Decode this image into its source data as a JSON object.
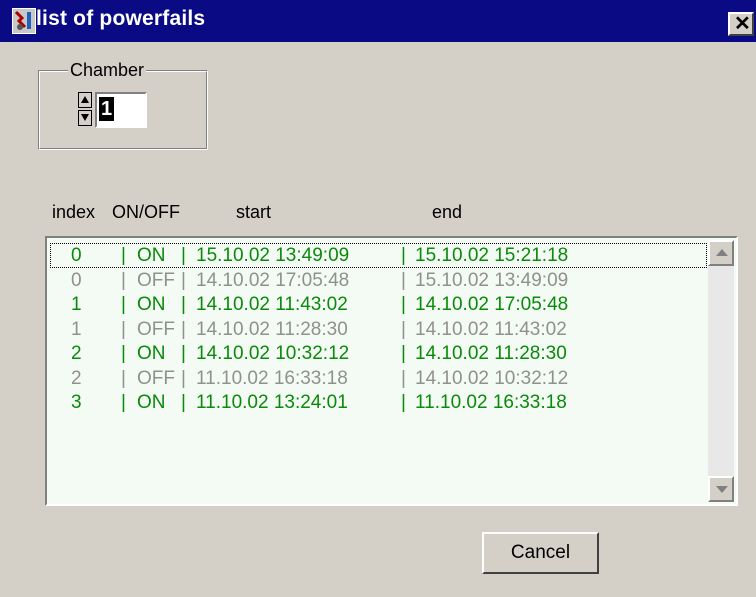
{
  "window": {
    "title": "list of powerfails",
    "close_glyph": "✕"
  },
  "chamber": {
    "legend": "Chamber",
    "value": "1"
  },
  "columns": {
    "index": "index",
    "onoff": "ON/OFF",
    "start": "start",
    "end": "end"
  },
  "rows": [
    {
      "index": "0",
      "state": "ON",
      "start": "15.10.02 13:49:09",
      "end": "15.10.02 15:21:18"
    },
    {
      "index": "0",
      "state": "OFF",
      "start": "14.10.02 17:05:48",
      "end": "15.10.02 13:49:09"
    },
    {
      "index": "1",
      "state": "ON",
      "start": "14.10.02 11:43:02",
      "end": "14.10.02 17:05:48"
    },
    {
      "index": "1",
      "state": "OFF",
      "start": "14.10.02 11:28:30",
      "end": "14.10.02 11:43:02"
    },
    {
      "index": "2",
      "state": "ON",
      "start": "14.10.02 10:32:12",
      "end": "14.10.02 11:28:30"
    },
    {
      "index": "2",
      "state": "OFF",
      "start": "11.10.02 16:33:18",
      "end": "14.10.02 10:32:12"
    },
    {
      "index": "3",
      "state": "ON",
      "start": "11.10.02 13:24:01",
      "end": "11.10.02 16:33:18"
    }
  ],
  "buttons": {
    "cancel": "Cancel"
  },
  "colors": {
    "on": "#0a8a0a",
    "off": "#909090",
    "titlebar": "#0a0a84"
  }
}
